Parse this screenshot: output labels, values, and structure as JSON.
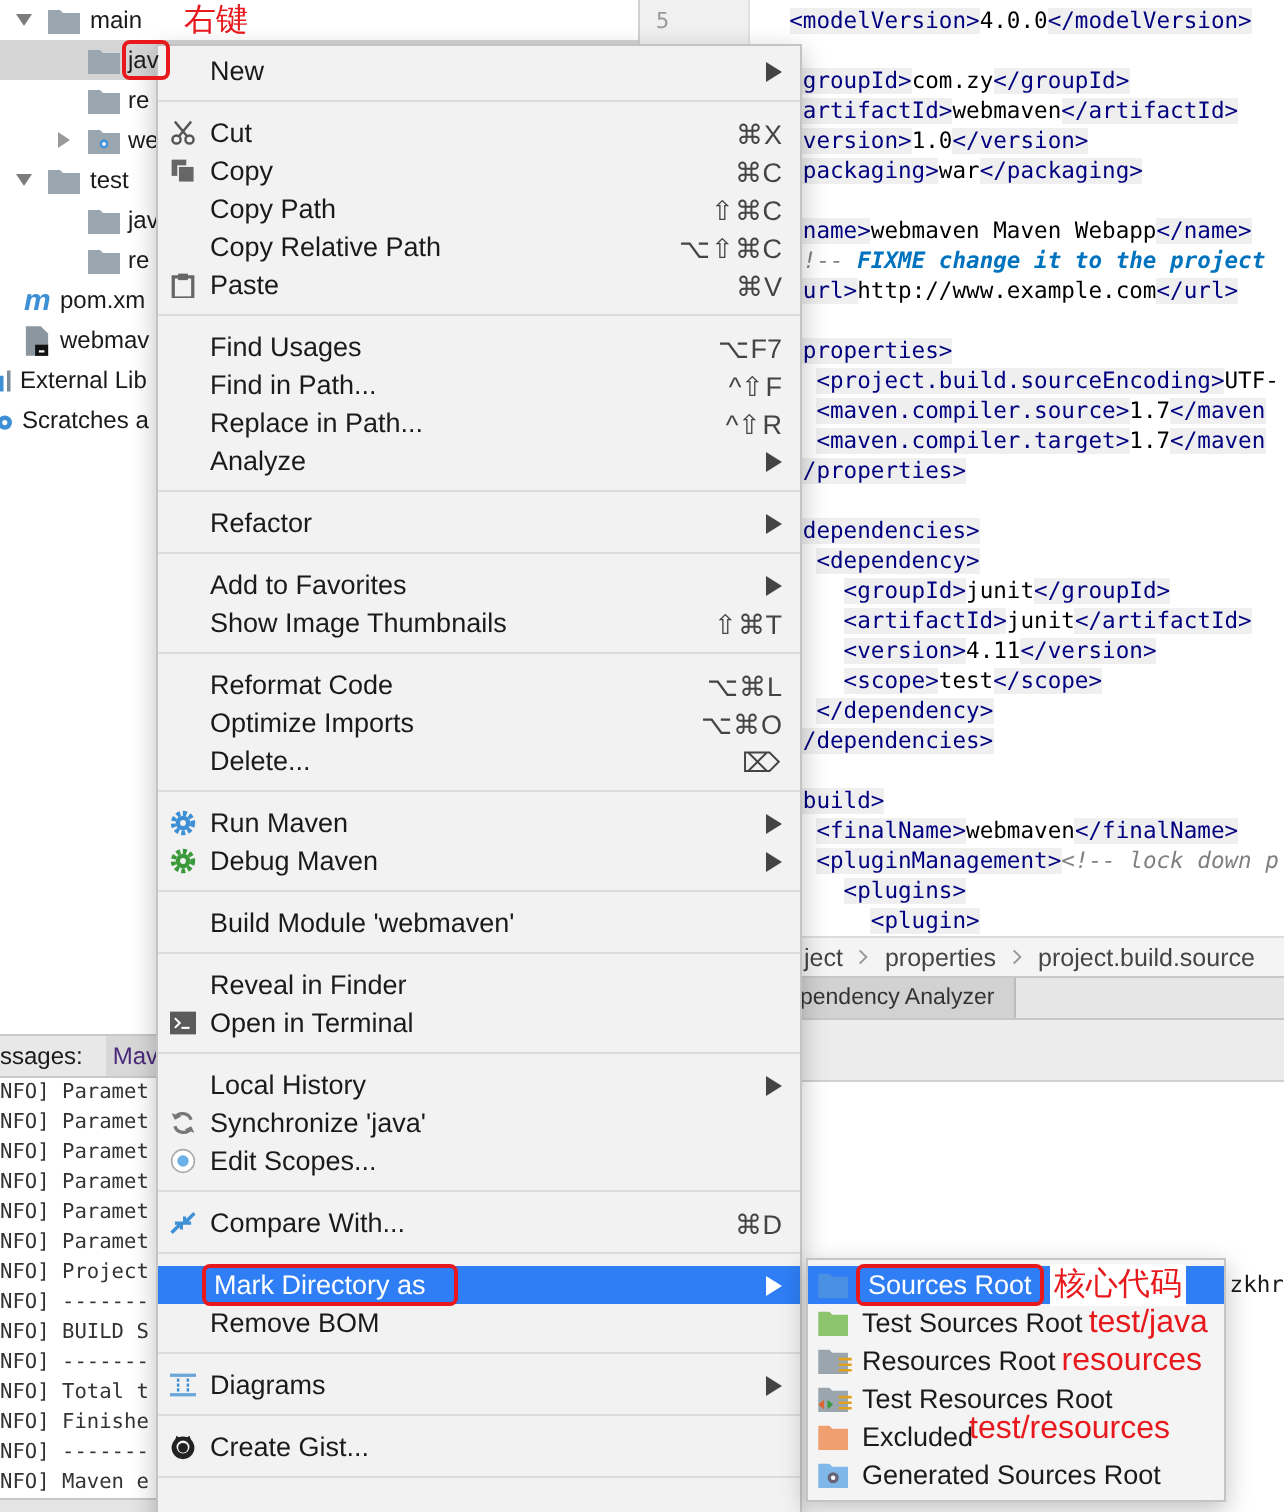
{
  "project_tree": {
    "folders": [
      {
        "label": "main",
        "expanded": true,
        "selected": false,
        "note": "右键",
        "children": [
          {
            "label": "jav",
            "selected": true,
            "annotated": true
          },
          {
            "label": "re",
            "selected": false,
            "annotated": false
          },
          {
            "label": "we",
            "selected": false,
            "annotated": false,
            "expanded": false
          }
        ]
      },
      {
        "label": "test",
        "expanded": true,
        "selected": false,
        "children": [
          {
            "label": "jav",
            "selected": false,
            "annotated": false
          },
          {
            "label": "re",
            "selected": false,
            "annotated": false
          }
        ]
      }
    ],
    "files": [
      {
        "label": "pom.xm",
        "badge": "m",
        "selected": false
      },
      {
        "label": "webmav",
        "selected": false
      }
    ],
    "roots": [
      {
        "label": "External Lib",
        "selected": false
      },
      {
        "label": "Scratches a",
        "selected": false
      }
    ]
  },
  "messages_panel": {
    "title": "ssages:",
    "tabs": [
      {
        "label": "Mav",
        "selected": true
      }
    ],
    "lines": [
      "NFO] Paramet",
      "NFO] Paramet",
      "NFO] Paramet",
      "NFO] Paramet",
      "NFO] Paramet",
      "NFO] Paramet",
      "NFO] Project",
      "NFO] -------",
      "NFO] BUILD S",
      "NFO] -------",
      "NFO] Total t",
      "NFO] Finishe",
      "NFO] -------",
      "NFO] Maven e"
    ]
  },
  "editor": {
    "gutter": [
      "5"
    ],
    "lines": [
      {
        "kind": "code",
        "segments": [
          {
            "kind": "tag",
            "text": "  <modelVersion>"
          },
          {
            "kind": "text",
            "text": "4.0.0"
          },
          {
            "kind": "tag",
            "text": "</modelVersion>"
          }
        ]
      },
      {
        "kind": "blank"
      },
      {
        "kind": "code",
        "segments": [
          {
            "kind": "tag",
            "text": "   groupId>"
          },
          {
            "kind": "text",
            "text": "com.zy"
          },
          {
            "kind": "tag",
            "text": "</groupId>"
          }
        ]
      },
      {
        "kind": "code",
        "segments": [
          {
            "kind": "tag",
            "text": "   artifactId>"
          },
          {
            "kind": "text",
            "text": "webmaven"
          },
          {
            "kind": "tag",
            "text": "</artifactId>"
          }
        ]
      },
      {
        "kind": "code",
        "segments": [
          {
            "kind": "tag",
            "text": "   version>"
          },
          {
            "kind": "text",
            "text": "1.0"
          },
          {
            "kind": "tag",
            "text": "</version>"
          }
        ]
      },
      {
        "kind": "code",
        "segments": [
          {
            "kind": "tag",
            "text": "   packaging>"
          },
          {
            "kind": "text",
            "text": "war"
          },
          {
            "kind": "tag",
            "text": "</packaging>"
          }
        ]
      },
      {
        "kind": "blank"
      },
      {
        "kind": "code",
        "segments": [
          {
            "kind": "tag",
            "text": "   name>"
          },
          {
            "kind": "text",
            "text": "webmaven Maven Webapp"
          },
          {
            "kind": "tag",
            "text": "</name>"
          }
        ]
      },
      {
        "kind": "code",
        "segments": [
          {
            "kind": "comment",
            "text": "   !-- "
          },
          {
            "kind": "todo",
            "text": "FIXME change it to the project"
          }
        ]
      },
      {
        "kind": "code",
        "segments": [
          {
            "kind": "tag",
            "text": "   url>"
          },
          {
            "kind": "text",
            "text": "http://www.example.com"
          },
          {
            "kind": "tag",
            "text": "</url>"
          }
        ]
      },
      {
        "kind": "blank"
      },
      {
        "kind": "code",
        "segments": [
          {
            "kind": "tag",
            "text": "   properties>"
          }
        ]
      },
      {
        "kind": "code",
        "segments": [
          {
            "kind": "tag",
            "text": "    <project.build.sourceEncoding>"
          },
          {
            "kind": "text",
            "text": "UTF-"
          }
        ]
      },
      {
        "kind": "code",
        "segments": [
          {
            "kind": "tag",
            "text": "    <maven.compiler.source>"
          },
          {
            "kind": "text",
            "text": "1.7"
          },
          {
            "kind": "tag",
            "text": "</maven"
          }
        ]
      },
      {
        "kind": "code",
        "segments": [
          {
            "kind": "tag",
            "text": "    <maven.compiler.target>"
          },
          {
            "kind": "text",
            "text": "1.7"
          },
          {
            "kind": "tag",
            "text": "</maven"
          }
        ]
      },
      {
        "kind": "code",
        "segments": [
          {
            "kind": "tag",
            "text": "   /properties>"
          }
        ]
      },
      {
        "kind": "blank"
      },
      {
        "kind": "code",
        "segments": [
          {
            "kind": "tag",
            "text": "   dependencies>"
          }
        ]
      },
      {
        "kind": "code",
        "segments": [
          {
            "kind": "tag",
            "text": "    <dependency>"
          }
        ]
      },
      {
        "kind": "code",
        "segments": [
          {
            "kind": "tag",
            "text": "      <groupId>"
          },
          {
            "kind": "text",
            "text": "junit"
          },
          {
            "kind": "tag",
            "text": "</groupId>"
          }
        ]
      },
      {
        "kind": "code",
        "segments": [
          {
            "kind": "tag",
            "text": "      <artifactId>"
          },
          {
            "kind": "text",
            "text": "junit"
          },
          {
            "kind": "tag",
            "text": "</artifactId>"
          }
        ]
      },
      {
        "kind": "code",
        "segments": [
          {
            "kind": "tag",
            "text": "      <version>"
          },
          {
            "kind": "text",
            "text": "4.11"
          },
          {
            "kind": "tag",
            "text": "</version>"
          }
        ]
      },
      {
        "kind": "code",
        "segments": [
          {
            "kind": "tag",
            "text": "      <scope>"
          },
          {
            "kind": "text",
            "text": "test"
          },
          {
            "kind": "tag",
            "text": "</scope>"
          }
        ]
      },
      {
        "kind": "code",
        "segments": [
          {
            "kind": "tag",
            "text": "    </dependency>"
          }
        ]
      },
      {
        "kind": "code",
        "segments": [
          {
            "kind": "tag",
            "text": "   /dependencies>"
          }
        ]
      },
      {
        "kind": "blank"
      },
      {
        "kind": "code",
        "segments": [
          {
            "kind": "tag",
            "text": "   build>"
          }
        ]
      },
      {
        "kind": "code",
        "segments": [
          {
            "kind": "tag",
            "text": "    <finalName>"
          },
          {
            "kind": "text",
            "text": "webmaven"
          },
          {
            "kind": "tag",
            "text": "</finalName>"
          }
        ]
      },
      {
        "kind": "code",
        "segments": [
          {
            "kind": "tag",
            "text": "    <pluginManagement>"
          },
          {
            "kind": "comment",
            "text": "<!-- lock down p"
          }
        ]
      },
      {
        "kind": "code",
        "segments": [
          {
            "kind": "tag",
            "text": "      <plugins>"
          }
        ]
      },
      {
        "kind": "code",
        "segments": [
          {
            "kind": "tag",
            "text": "        <plugin>"
          }
        ]
      }
    ]
  },
  "breadcrumb": [
    "ject",
    "properties",
    "project.build.source"
  ],
  "tool_tab": "pendency Analyzer",
  "output_fragment": "zkhr",
  "context_menu": {
    "groups": [
      [
        {
          "label": "New",
          "submenu": true,
          "selected": false,
          "annotated": false
        }
      ],
      [
        {
          "label": "Cut",
          "shortcut": "⌘X",
          "submenu": false,
          "selected": false,
          "annotated": false
        },
        {
          "label": "Copy",
          "shortcut": "⌘C",
          "submenu": false,
          "selected": false,
          "annotated": false
        },
        {
          "label": "Copy Path",
          "shortcut": "⇧⌘C",
          "submenu": false,
          "selected": false,
          "annotated": false
        },
        {
          "label": "Copy Relative Path",
          "shortcut": "⌥⇧⌘C",
          "submenu": false,
          "selected": false,
          "annotated": false
        },
        {
          "label": "Paste",
          "shortcut": "⌘V",
          "submenu": false,
          "selected": false,
          "annotated": false
        }
      ],
      [
        {
          "label": "Find Usages",
          "shortcut": "⌥F7",
          "submenu": false,
          "selected": false,
          "annotated": false
        },
        {
          "label": "Find in Path...",
          "shortcut": "^⇧F",
          "submenu": false,
          "selected": false,
          "annotated": false
        },
        {
          "label": "Replace in Path...",
          "shortcut": "^⇧R",
          "submenu": false,
          "selected": false,
          "annotated": false
        },
        {
          "label": "Analyze",
          "submenu": true,
          "selected": false,
          "annotated": false
        }
      ],
      [
        {
          "label": "Refactor",
          "submenu": true,
          "selected": false,
          "annotated": false
        }
      ],
      [
        {
          "label": "Add to Favorites",
          "submenu": true,
          "selected": false,
          "annotated": false
        },
        {
          "label": "Show Image Thumbnails",
          "shortcut": "⇧⌘T",
          "submenu": false,
          "selected": false,
          "annotated": false
        }
      ],
      [
        {
          "label": "Reformat Code",
          "shortcut": "⌥⌘L",
          "submenu": false,
          "selected": false,
          "annotated": false
        },
        {
          "label": "Optimize Imports",
          "shortcut": "⌥⌘O",
          "submenu": false,
          "selected": false,
          "annotated": false
        },
        {
          "label": "Delete...",
          "shortcut": "⌦",
          "submenu": false,
          "selected": false,
          "annotated": false
        }
      ],
      [
        {
          "label": "Run Maven",
          "submenu": true,
          "selected": false,
          "annotated": false
        },
        {
          "label": "Debug Maven",
          "submenu": true,
          "selected": false,
          "annotated": false
        }
      ],
      [
        {
          "label": "Build Module 'webmaven'",
          "submenu": false,
          "selected": false,
          "annotated": false
        }
      ],
      [
        {
          "label": "Reveal in Finder",
          "submenu": false,
          "selected": false,
          "annotated": false
        },
        {
          "label": "Open in Terminal",
          "submenu": false,
          "selected": false,
          "annotated": false
        }
      ],
      [
        {
          "label": "Local History",
          "submenu": true,
          "selected": false,
          "annotated": false
        },
        {
          "label": "Synchronize 'java'",
          "submenu": false,
          "selected": false,
          "annotated": false
        },
        {
          "label": "Edit Scopes...",
          "submenu": false,
          "selected": false,
          "annotated": false
        }
      ],
      [
        {
          "label": "Compare With...",
          "shortcut": "⌘D",
          "submenu": false,
          "selected": false,
          "annotated": false
        }
      ],
      [
        {
          "label": "Mark Directory as",
          "submenu": true,
          "selected": true,
          "annotated": true
        },
        {
          "label": "Remove BOM",
          "submenu": false,
          "selected": false,
          "annotated": false
        }
      ],
      [
        {
          "label": "Diagrams",
          "submenu": true,
          "selected": false,
          "annotated": false
        }
      ],
      [
        {
          "label": "Create Gist...",
          "submenu": false,
          "selected": false,
          "annotated": false
        }
      ]
    ]
  },
  "submenu": [
    {
      "label": "Sources Root",
      "selected": true,
      "annotated": true,
      "note": "核心代码"
    },
    {
      "label": "Test Sources Root",
      "selected": false,
      "annotated": false,
      "note": "test/java"
    },
    {
      "label": "Resources Root",
      "selected": false,
      "annotated": false,
      "note": "resources"
    },
    {
      "label": "Test Resources Root",
      "selected": false,
      "annotated": false
    },
    {
      "label": "Excluded",
      "selected": false,
      "annotated": false,
      "note": "test/resources"
    },
    {
      "label": "Generated Sources Root",
      "selected": false,
      "annotated": false
    }
  ]
}
